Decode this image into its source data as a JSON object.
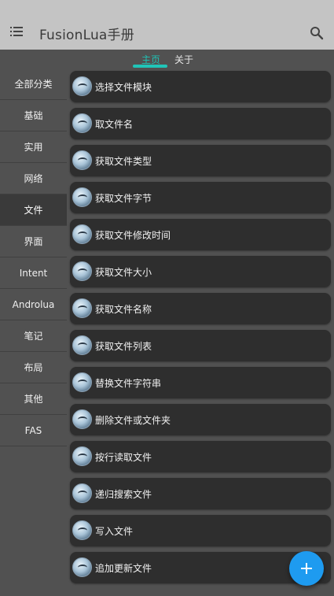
{
  "app": {
    "title": "FusionLua手册"
  },
  "icons": {
    "menu": "menu-icon",
    "search": "search-icon",
    "add": "plus-icon",
    "avatar": "avatar-icon"
  },
  "colors": {
    "appbar": "#c4c4c4",
    "accent": "#20c5b8",
    "fab": "#1e9bf0",
    "background": "#515151",
    "card": "#2e2e2e"
  },
  "tabs": [
    {
      "label": "主页",
      "active": true
    },
    {
      "label": "关于",
      "active": false
    }
  ],
  "sidebar": {
    "items": [
      {
        "label": "全部分类"
      },
      {
        "label": "基础"
      },
      {
        "label": "实用"
      },
      {
        "label": "网络"
      },
      {
        "label": "文件",
        "active": true
      },
      {
        "label": "界面"
      },
      {
        "label": "Intent"
      },
      {
        "label": "Androlua"
      },
      {
        "label": "笔记"
      },
      {
        "label": "布局"
      },
      {
        "label": "其他"
      },
      {
        "label": "FAS"
      }
    ]
  },
  "list": {
    "items": [
      {
        "label": "选择文件模块"
      },
      {
        "label": "取文件名"
      },
      {
        "label": "获取文件类型"
      },
      {
        "label": "获取文件字节"
      },
      {
        "label": "获取文件修改时间"
      },
      {
        "label": "获取文件大小"
      },
      {
        "label": "获取文件名称"
      },
      {
        "label": "获取文件列表"
      },
      {
        "label": "替换文件字符串"
      },
      {
        "label": "删除文件或文件夹"
      },
      {
        "label": "按行读取文件"
      },
      {
        "label": "递归搜索文件"
      },
      {
        "label": "写入文件"
      },
      {
        "label": "追加更新文件"
      }
    ]
  }
}
